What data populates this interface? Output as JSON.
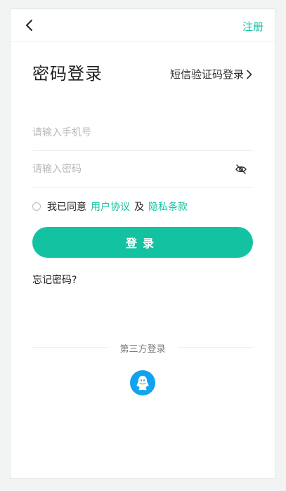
{
  "header": {
    "back_icon": "chevron-left-icon",
    "register_label": "注册"
  },
  "main": {
    "title": "密码登录",
    "sms_login_label": "短信验证码登录",
    "sms_login_icon": "chevron-right-icon",
    "phone_placeholder": "请输入手机号",
    "phone_value": "",
    "password_placeholder": "请输入密码",
    "password_value": "",
    "password_toggle_icon": "eye-off-icon",
    "agreement": {
      "checked": false,
      "prefix": "我已同意",
      "user_agreement": "用户协议",
      "and": "及",
      "privacy_policy": "隐私条款"
    },
    "login_button": "登录",
    "forgot_password": "忘记密码?"
  },
  "third_party": {
    "label": "第三方登录",
    "providers": [
      {
        "name": "qq",
        "icon": "qq-icon",
        "color": "#12a3ee"
      }
    ]
  },
  "colors": {
    "accent": "#13c2a1",
    "background": "#f2f3f3",
    "card": "#ffffff"
  }
}
